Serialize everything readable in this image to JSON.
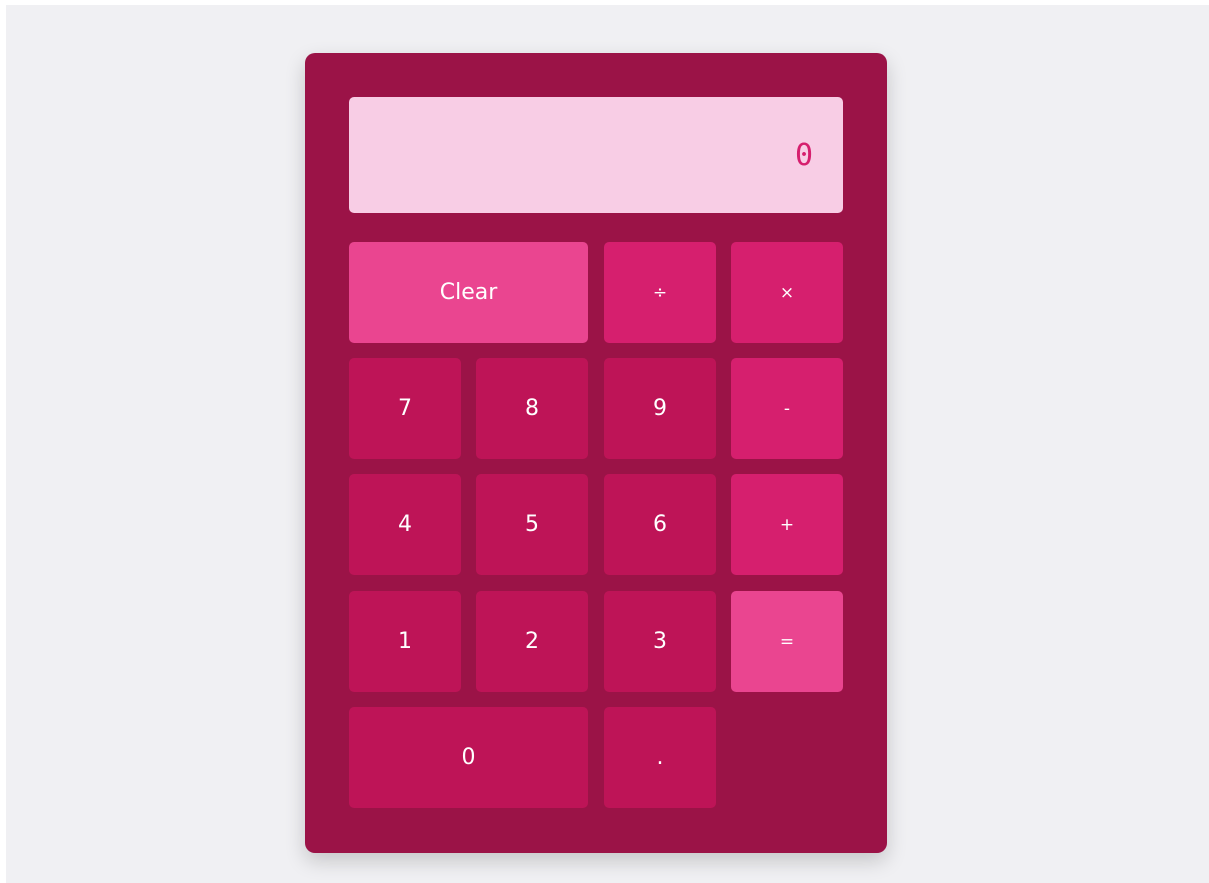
{
  "display": {
    "value": "0"
  },
  "keys": {
    "clear": "Clear",
    "divide": "÷",
    "multiply": "×",
    "seven": "7",
    "eight": "8",
    "nine": "9",
    "minus": "-",
    "four": "4",
    "five": "5",
    "six": "6",
    "plus": "+",
    "one": "1",
    "two": "2",
    "three": "3",
    "equals": "=",
    "zero": "0",
    "decimal": "."
  },
  "colors": {
    "background": "#f0f0f3",
    "body": "#9b1347",
    "display_bg": "#f8cde5",
    "display_text": "#d61f6e",
    "number_key": "#be1457",
    "operator_key": "#d61f6e",
    "accent_key": "#ea4590"
  }
}
